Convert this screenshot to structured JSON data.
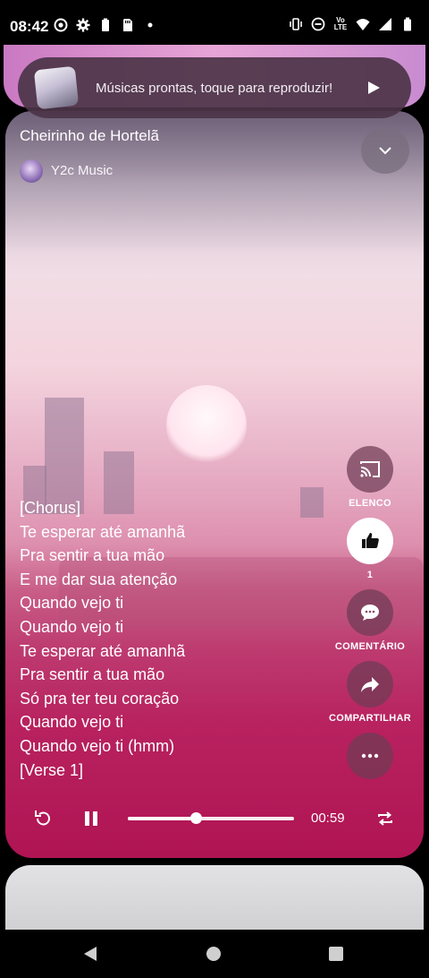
{
  "status_bar": {
    "time": "08:42",
    "left_icons": [
      "record-icon",
      "settings-icon",
      "battery-saver-icon",
      "sd-card-icon",
      "dot-icon"
    ],
    "right_icons": [
      "vibrate-icon",
      "do-not-disturb-icon",
      "volte-lte-icon",
      "wifi-icon",
      "signal-icon",
      "battery-icon"
    ],
    "lte_label": "Vo LTE"
  },
  "banner": {
    "text": "Músicas prontas, toque para reproduzir!"
  },
  "song": {
    "title": "Cheirinho de Hortelã",
    "artist": "Y2c Music"
  },
  "lyrics": [
    "[Chorus]",
    "Te esperar até amanhã",
    "Pra sentir a tua mão",
    "E me dar sua atenção",
    "Quando vejo ti",
    "Quando vejo ti",
    "Te esperar até amanhã",
    "Pra sentir a tua mão",
    "Só pra ter teu coração",
    "Quando vejo ti",
    "Quando vejo ti (hmm)",
    "[Verse 1]"
  ],
  "actions": {
    "cast_label": "ELENCO",
    "like_count": "1",
    "comment_label": "COMENTÁRIO",
    "share_label": "COMPARTILHAR"
  },
  "player": {
    "elapsed": "00:59",
    "progress_fraction": 0.41
  },
  "colors": {
    "accent": "#b8225f",
    "card_top": "#e7a5d6"
  }
}
